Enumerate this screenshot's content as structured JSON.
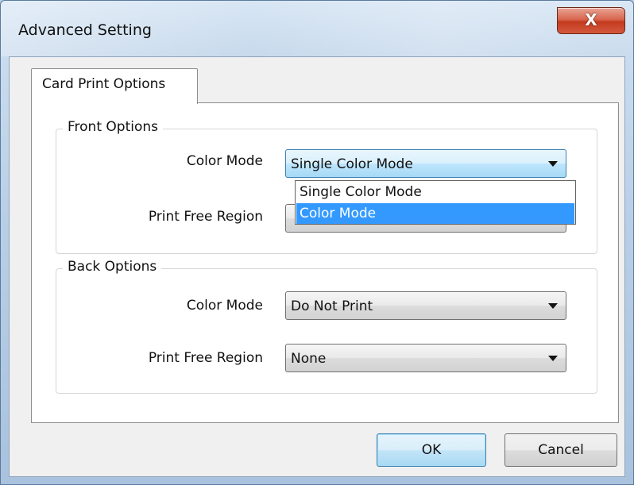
{
  "window": {
    "title": "Advanced Setting",
    "close_glyph": "X"
  },
  "tab": {
    "label": "Card Print Options"
  },
  "front_options": {
    "legend": "Front Options",
    "color_mode_label": "Color Mode",
    "color_mode_value": "Single Color Mode",
    "print_free_region_label": "Print Free Region",
    "dropdown_options": [
      {
        "label": "Single Color Mode",
        "highlighted": false
      },
      {
        "label": "Color Mode",
        "highlighted": true
      }
    ]
  },
  "back_options": {
    "legend": "Back Options",
    "color_mode_label": "Color Mode",
    "color_mode_value": "Do Not Print",
    "print_free_region_label": "Print Free Region",
    "print_free_region_value": "None"
  },
  "buttons": {
    "ok_label": "OK",
    "cancel_label": "Cancel"
  },
  "colors": {
    "highlight": "#3399ff",
    "close_button": "#c43b1f",
    "focus_border": "#3c7fb1"
  },
  "icons": {
    "dropdown_arrow": "chevron-down-icon",
    "close": "close-icon"
  }
}
